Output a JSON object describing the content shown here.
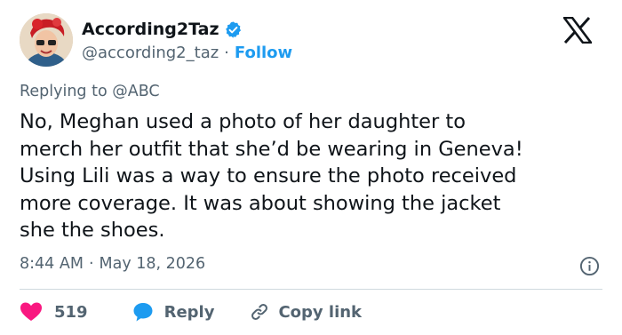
{
  "author": {
    "display_name": "According2Taz",
    "handle": "@according2_taz",
    "separator": "·",
    "follow_label": "Follow"
  },
  "reply_context": {
    "prefix": "Replying to",
    "mention": "@ABC"
  },
  "tweet": {
    "text": "No, Meghan used a photo of her daughter to\nmerch her outfit that she’d be wearing in Geneva!\nUsing Lili was a way to ensure the photo received\nmore coverage.  It was about showing the jacket\nshe the shoes."
  },
  "meta": {
    "time": "8:44 AM",
    "separator": "·",
    "date": "May 18, 2026"
  },
  "actions": {
    "like_count": "519",
    "reply_label": "Reply",
    "copy_link_label": "Copy link"
  },
  "colors": {
    "accent": "#1d9bf0",
    "like": "#f91880",
    "text": "#0f1419",
    "muted": "#536471",
    "divider": "#cfd9de"
  },
  "icons": {
    "verified": "verified-badge-icon",
    "logo": "x-logo-icon",
    "info": "info-icon",
    "like": "heart-icon",
    "reply": "speech-bubble-icon",
    "copy": "link-icon"
  }
}
